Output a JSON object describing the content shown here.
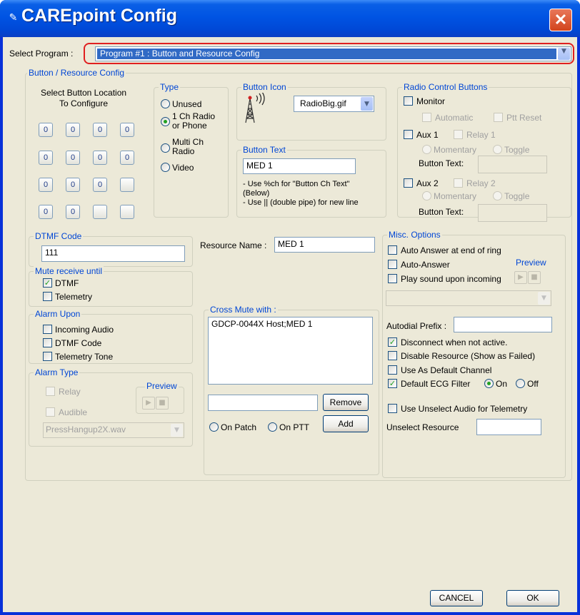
{
  "window": {
    "title": "CAREpoint Config",
    "close": "✕"
  },
  "program": {
    "label": "Select Program :",
    "value": "Program #1 : Button and Resource Config",
    "highlight": "#e02020",
    "selected_bg": "#316ac5"
  },
  "button_resource": {
    "title": "Button / Resource Config"
  },
  "location": {
    "heading": "Select Button Location\nTo Configure",
    "grid": [
      [
        "0",
        "0",
        "0",
        "0"
      ],
      [
        "0",
        "0",
        "0",
        "0"
      ],
      [
        "0",
        "0",
        "0",
        ""
      ],
      [
        "0",
        "0",
        "",
        ""
      ]
    ]
  },
  "type": {
    "title": "Type",
    "options": [
      "Unused",
      "1 Ch Radio\nor Phone",
      "Multi Ch\nRadio",
      "Video"
    ],
    "selected": "1 Ch Radio or Phone"
  },
  "icon": {
    "title": "Button Icon",
    "value": "RadioBig.gif",
    "image": "antenna-icon"
  },
  "button_text": {
    "title": "Button Text",
    "value": "MED 1",
    "help": "- Use %ch for \"Button Ch Text\"\n(Below)\n- Use || (double pipe) for new line"
  },
  "radio_control": {
    "title": "Radio Control Buttons",
    "monitor": "Monitor",
    "automatic": "Automatic",
    "ptt_reset": "Ptt Reset",
    "aux1": "Aux 1",
    "relay1": "Relay 1",
    "aux2": "Aux 2",
    "relay2": "Relay 2",
    "momentary": "Momentary",
    "toggle": "Toggle",
    "button_text": "Button Text:"
  },
  "dtmf": {
    "title": "DTMF Code",
    "value": "111"
  },
  "mute": {
    "title": "Mute receive until",
    "dtmf": "DTMF",
    "telemetry": "Telemetry"
  },
  "alarm_upon": {
    "title": "Alarm Upon",
    "incoming": "Incoming Audio",
    "dtmf": "DTMF Code",
    "tone": "Telemetry Tone"
  },
  "alarm_type": {
    "title": "Alarm Type",
    "relay": "Relay",
    "audible": "Audible",
    "preview": "Preview",
    "wav": "PressHangup2X.wav"
  },
  "resource": {
    "label": "Resource Name :",
    "value": "MED 1"
  },
  "cross_mute": {
    "title": "Cross Mute with :",
    "list": "GDCP-0044X Host;MED 1",
    "remove": "Remove",
    "add": "Add",
    "on_patch": "On Patch",
    "on_ptt": "On PTT"
  },
  "misc": {
    "title": "Misc. Options",
    "auto_answer_end": "Auto Answer at end of ring",
    "auto_answer": "Auto-Answer",
    "play_sound": "Play sound upon incoming",
    "preview": "Preview",
    "autodial": "Autodial Prefix :",
    "disconnect": "Disconnect when not active.",
    "disable": "Disable Resource (Show as Failed)",
    "default_channel": "Use As Default Channel",
    "ecg": "Default ECG Filter",
    "on": "On",
    "off": "Off",
    "unselect_audio": "Use Unselect Audio for Telemetry",
    "unselect_resource": "Unselect Resource"
  },
  "footer": {
    "cancel": "CANCEL",
    "ok": "OK"
  }
}
